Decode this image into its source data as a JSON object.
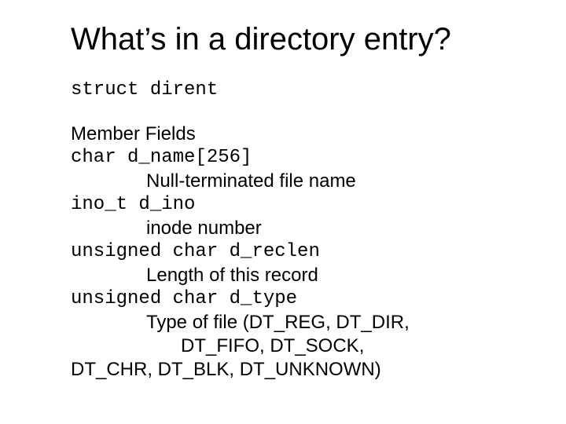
{
  "title": "What’s in a directory entry?",
  "struct_decl": "struct dirent",
  "section_header": "Member Fields",
  "fields": {
    "f0": {
      "decl": "char d_name[256]",
      "desc": "Null-terminated file name"
    },
    "f1": {
      "decl": "ino_t d_ino",
      "desc": "inode number"
    },
    "f2": {
      "decl": "unsigned char d_reclen",
      "desc": "Length of this record"
    },
    "f3": {
      "decl": "unsigned char d_type"
    }
  },
  "d_type_desc": {
    "l1": "Type of file (DT_REG, DT_DIR,",
    "l2": "DT_FIFO, DT_SOCK,",
    "l3": "DT_CHR, DT_BLK, DT_UNKNOWN)"
  }
}
